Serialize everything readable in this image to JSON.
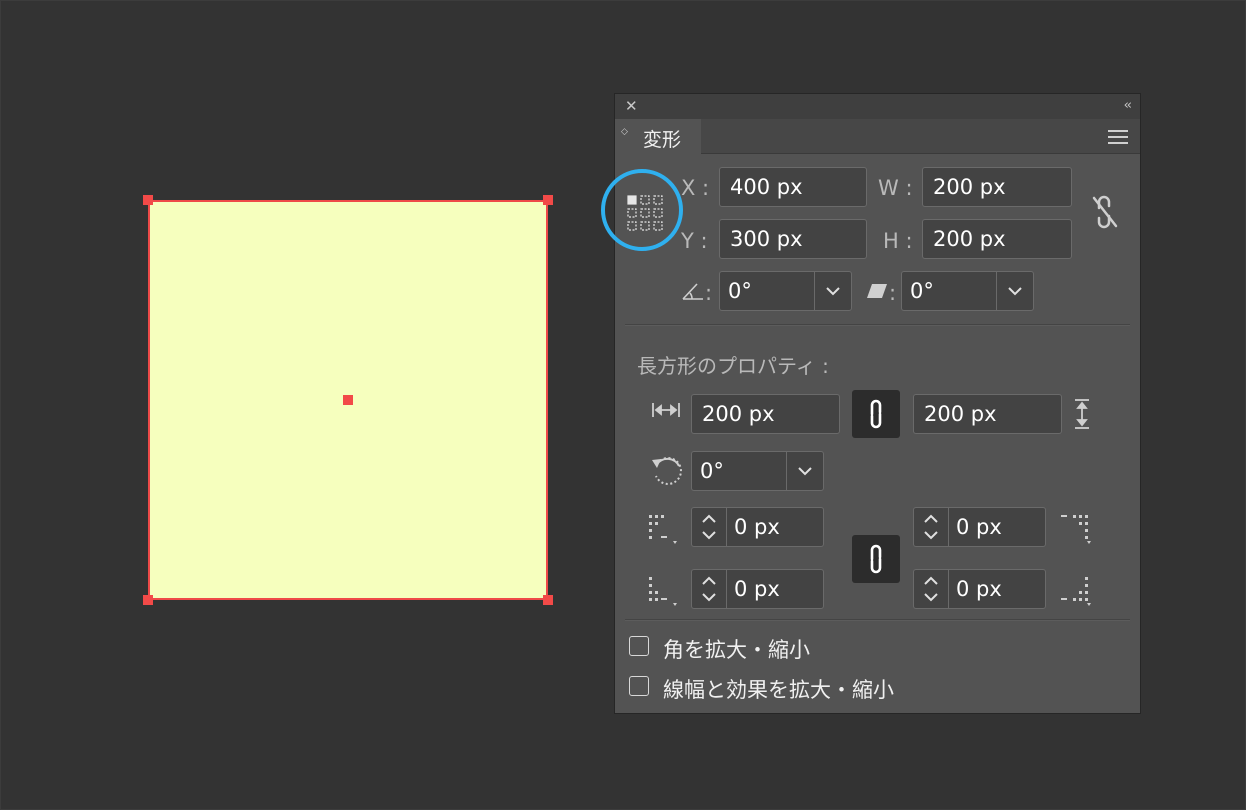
{
  "panel": {
    "title": "変形",
    "position": {
      "x_label": "X :",
      "x_value": "400 px",
      "y_label": "Y :",
      "y_value": "300 px"
    },
    "size": {
      "w_label": "W :",
      "w_value": "200 px",
      "h_label": "H :",
      "h_value": "200 px"
    },
    "rotate": {
      "label": ":",
      "value": "0°"
    },
    "shear": {
      "label": ":",
      "value": "0°"
    },
    "rect_props": {
      "heading": "長方形のプロパティ :",
      "width_value": "200 px",
      "height_value": "200 px",
      "rotation_value": "0°",
      "corner_tl": "0 px",
      "corner_tr": "0 px",
      "corner_bl": "0 px",
      "corner_br": "0 px"
    },
    "options": {
      "scale_corners": "角を拡大・縮小",
      "scale_strokes": "線幅と効果を拡大・縮小"
    }
  },
  "colors": {
    "shape_fill": "#f6ffbe",
    "shape_stroke": "#ee4a48",
    "highlight_ring": "#2fb0ef"
  }
}
